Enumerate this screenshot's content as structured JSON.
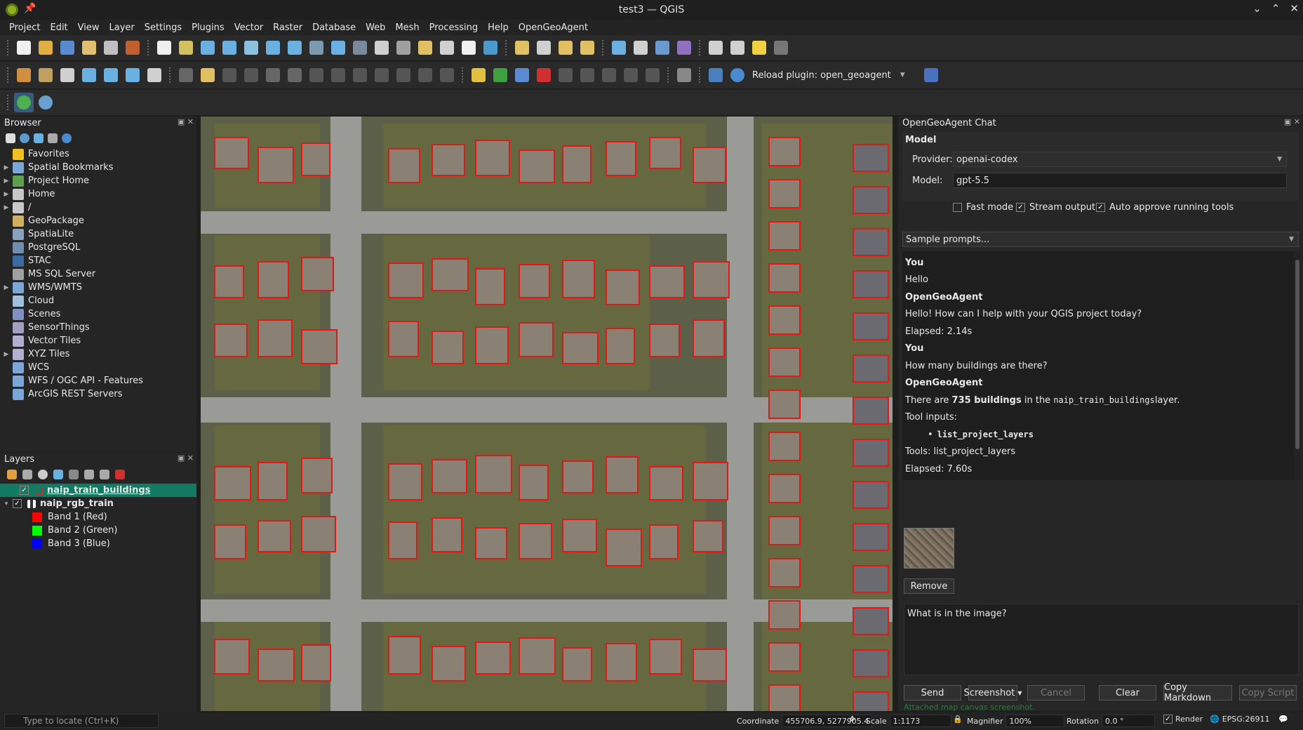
{
  "window": {
    "title": "test3 — QGIS"
  },
  "menu": [
    "Project",
    "Edit",
    "View",
    "Layer",
    "Settings",
    "Plugins",
    "Vector",
    "Raster",
    "Database",
    "Web",
    "Mesh",
    "Processing",
    "Help",
    "OpenGeoAgent"
  ],
  "toolbar": {
    "reload_label": "Reload plugin: open_geoagent"
  },
  "browser": {
    "title": "Browser",
    "items": [
      {
        "label": "Favorites",
        "arrow": "",
        "color": "#f0c020"
      },
      {
        "label": "Spatial Bookmarks",
        "arrow": "▶",
        "color": "#7aa7d8"
      },
      {
        "label": "Project Home",
        "arrow": "▶",
        "color": "#5fa050"
      },
      {
        "label": "Home",
        "arrow": "▶",
        "color": "#c8c8c8"
      },
      {
        "label": "/",
        "arrow": "▶",
        "color": "#c8c8c8"
      },
      {
        "label": "GeoPackage",
        "arrow": "",
        "color": "#d0b060"
      },
      {
        "label": "SpatiaLite",
        "arrow": "",
        "color": "#8aa0c0"
      },
      {
        "label": "PostgreSQL",
        "arrow": "",
        "color": "#6f8fb0"
      },
      {
        "label": "STAC",
        "arrow": "",
        "color": "#3a6aa0"
      },
      {
        "label": "MS SQL Server",
        "arrow": "",
        "color": "#a0a0a0"
      },
      {
        "label": "WMS/WMTS",
        "arrow": "▶",
        "color": "#7aa7d8"
      },
      {
        "label": "Cloud",
        "arrow": "",
        "color": "#a0c0e0"
      },
      {
        "label": "Scenes",
        "arrow": "",
        "color": "#8090c0"
      },
      {
        "label": "SensorThings",
        "arrow": "",
        "color": "#a0a0c0"
      },
      {
        "label": "Vector Tiles",
        "arrow": "",
        "color": "#b0b0d0"
      },
      {
        "label": "XYZ Tiles",
        "arrow": "▶",
        "color": "#b0b0d0"
      },
      {
        "label": "WCS",
        "arrow": "",
        "color": "#7aa7d8"
      },
      {
        "label": "WFS / OGC API - Features",
        "arrow": "",
        "color": "#7aa7d8"
      },
      {
        "label": "ArcGIS REST Servers",
        "arrow": "",
        "color": "#7aa7d8"
      }
    ]
  },
  "layers": {
    "title": "Layers",
    "items": [
      {
        "label": "naip_train_buildings",
        "checked": "✓"
      },
      {
        "label": "naip_rgb_train",
        "checked": "✓"
      }
    ],
    "bands": [
      {
        "label": "Band 1 (Red)",
        "color": "#ff0000"
      },
      {
        "label": "Band 2 (Green)",
        "color": "#00ff00"
      },
      {
        "label": "Band 3 (Blue)",
        "color": "#0000ff"
      }
    ]
  },
  "chat": {
    "title": "OpenGeoAgent Chat",
    "model_title": "Model",
    "provider_label": "Provider:",
    "provider_value": "openai-codex",
    "model_label": "Model:",
    "model_value": "gpt-5.5",
    "fast_mode": "Fast mode",
    "stream_output": "Stream output",
    "auto_approve": "Auto approve running tools",
    "sample_prompts": "Sample prompts...",
    "messages": {
      "you1": "You",
      "hello": "Hello",
      "agent1": "OpenGeoAgent",
      "reply1": "Hello! How can I help with your QGIS project today?",
      "elapsed1": "Elapsed: 2.14s",
      "you2": "You",
      "question2": "How many buildings are there?",
      "agent2": "OpenGeoAgent",
      "reply2_pre": "There are ",
      "reply2_bold": "735 buildings",
      "reply2_mid": " in the ",
      "reply2_code": "naip_train_buildings",
      "reply2_post": " layer.",
      "tool_inputs": "Tool inputs:",
      "tool_name": "list_project_layers",
      "tools_line": "Tools: list_project_layers",
      "elapsed2": "Elapsed: 7.60s"
    },
    "remove_label": "Remove",
    "input_value": "What is in the image?",
    "buttons": {
      "send": "Send",
      "screenshot": "Screenshot",
      "cancel": "Cancel",
      "clear": "Clear",
      "copy_markdown": "Copy Markdown",
      "copy_script": "Copy Script"
    },
    "status": "Attached map canvas screenshot."
  },
  "statusbar": {
    "locate_placeholder": "Type to locate (Ctrl+K)",
    "coordinate_label": "Coordinate",
    "coordinate_value": "455706.9, 5277905.4",
    "scale_label": "Scale",
    "scale_value": "1:1173",
    "magnifier_label": "Magnifier",
    "magnifier_value": "100%",
    "rotation_label": "Rotation",
    "rotation_value": "0.0 °",
    "render_label": "Render",
    "crs": "EPSG:26911"
  }
}
